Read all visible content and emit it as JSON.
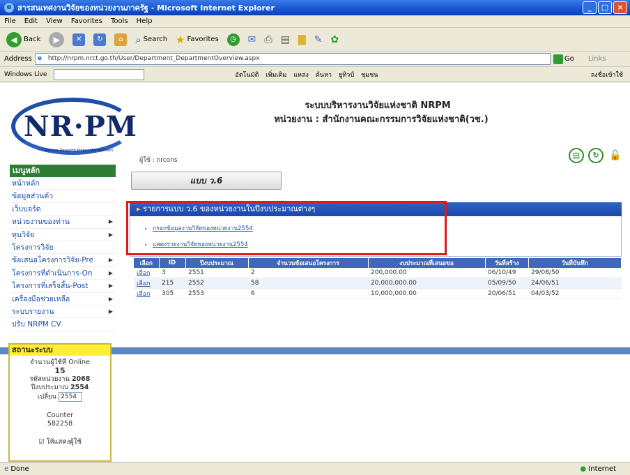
{
  "window": {
    "title": "สารสนเทศงานวิจัยของหน่วยงานภาครัฐ - Microsoft Internet Explorer",
    "controls": [
      "_",
      "□",
      "×"
    ]
  },
  "menubar": [
    "File",
    "Edit",
    "View",
    "Favorites",
    "Tools",
    "Help"
  ],
  "toolbar": {
    "back": "Back",
    "search": "Search",
    "favorites": "Favorites"
  },
  "address": {
    "label": "Address",
    "url": "http://nrpm.nrct.go.th/User/Department_DepartmentOverview.aspx",
    "go": "Go",
    "links": "Links"
  },
  "linksbar": {
    "windows_live": "Windows Live",
    "items": [
      "อัตโนมัติ",
      "เพิ่มเติม",
      "แหล่ง",
      "ค้นหา",
      "ยูทิวป์",
      "ชุมชน"
    ],
    "right": "ลงชื่อเข้าใช้"
  },
  "header": {
    "logo": "NR·PM",
    "logo_sub": "National Research Project Management",
    "user": "ผู้ใช้ : nrcons",
    "site_title": "ระบบบริหารงานวิจัยแห่งชาติ NRPM",
    "agency": "หน่วยงาน : สำนักงานคณะกรรมการวิจัยแห่งชาติ(วช.)"
  },
  "sidebar": {
    "title": "เมนูหลัก",
    "items": [
      {
        "label": "หน้าหลัก",
        "arrow": ""
      },
      {
        "label": "ข้อมูลส่วนตัว",
        "arrow": ""
      },
      {
        "label": "เว็บบอร์ด",
        "arrow": ""
      },
      {
        "label": "หน่วยงานของท่าน",
        "arrow": "▶"
      },
      {
        "label": "ทุนวิจัย",
        "arrow": "▶"
      },
      {
        "label": "โครงการวิจัย",
        "arrow": ""
      },
      {
        "label": "ข้อเสนอโครงการวิจัย-Pre",
        "arrow": "▶"
      },
      {
        "label": "โครงการที่ดำเนินการ-On",
        "arrow": "▶"
      },
      {
        "label": "โครงการที่เสร็จสิ้น-Post",
        "arrow": "▶"
      },
      {
        "label": "เครื่องมือช่วยเหลือ",
        "arrow": "▶"
      },
      {
        "label": "ระบบรายงาน",
        "arrow": "▶"
      },
      {
        "label": "ปรับ NRPM CV",
        "arrow": ""
      }
    ]
  },
  "status": {
    "title": "สถานะระบบ",
    "online_label": "จำนวนผู้ใช้ที่ Online",
    "online_count": "15",
    "budget_year_label": "รหัสหน่วยงาน",
    "budget_year_value": "2068",
    "fiscal_label": "ปีงบประมาณ",
    "fiscal_value": "2554",
    "select_label": "เปลี่ยน",
    "select_value": "2554",
    "counter_label": "Counter",
    "counter_value": "582258",
    "remember": "ให้แสดงผู้ใช้"
  },
  "main": {
    "form_button": "แบบ ว.6",
    "panel_title": "รายการแบบ ว.6 ของหน่วยงานในปีงบประมาณต่างๆ",
    "links": [
      "กรอกข้อมูลงานวิจัยของหน่วยงาน2554",
      "แสดงรายงานวิจัยของหน่วยงาน2554"
    ],
    "table": {
      "headers": [
        "เลือก",
        "ID",
        "ปีงบประมาณ",
        "จำนวนข้อเสนอโครงการ",
        "งบประมาณที่เสนอขอ",
        "วันที่สร้าง",
        "วันที่บันทึก"
      ],
      "rows": [
        [
          "เลือก",
          "3",
          "2551",
          "2",
          "200,000.00",
          "06/10/49",
          "29/08/50"
        ],
        [
          "เลือก",
          "215",
          "2552",
          "58",
          "20,000,000.00",
          "05/09/50",
          "24/06/51"
        ],
        [
          "เลือก",
          "305",
          "2553",
          "6",
          "10,000,000.00",
          "20/06/51",
          "04/03/52"
        ]
      ]
    }
  },
  "statusbar": {
    "left": "Done",
    "right": "Internet"
  }
}
